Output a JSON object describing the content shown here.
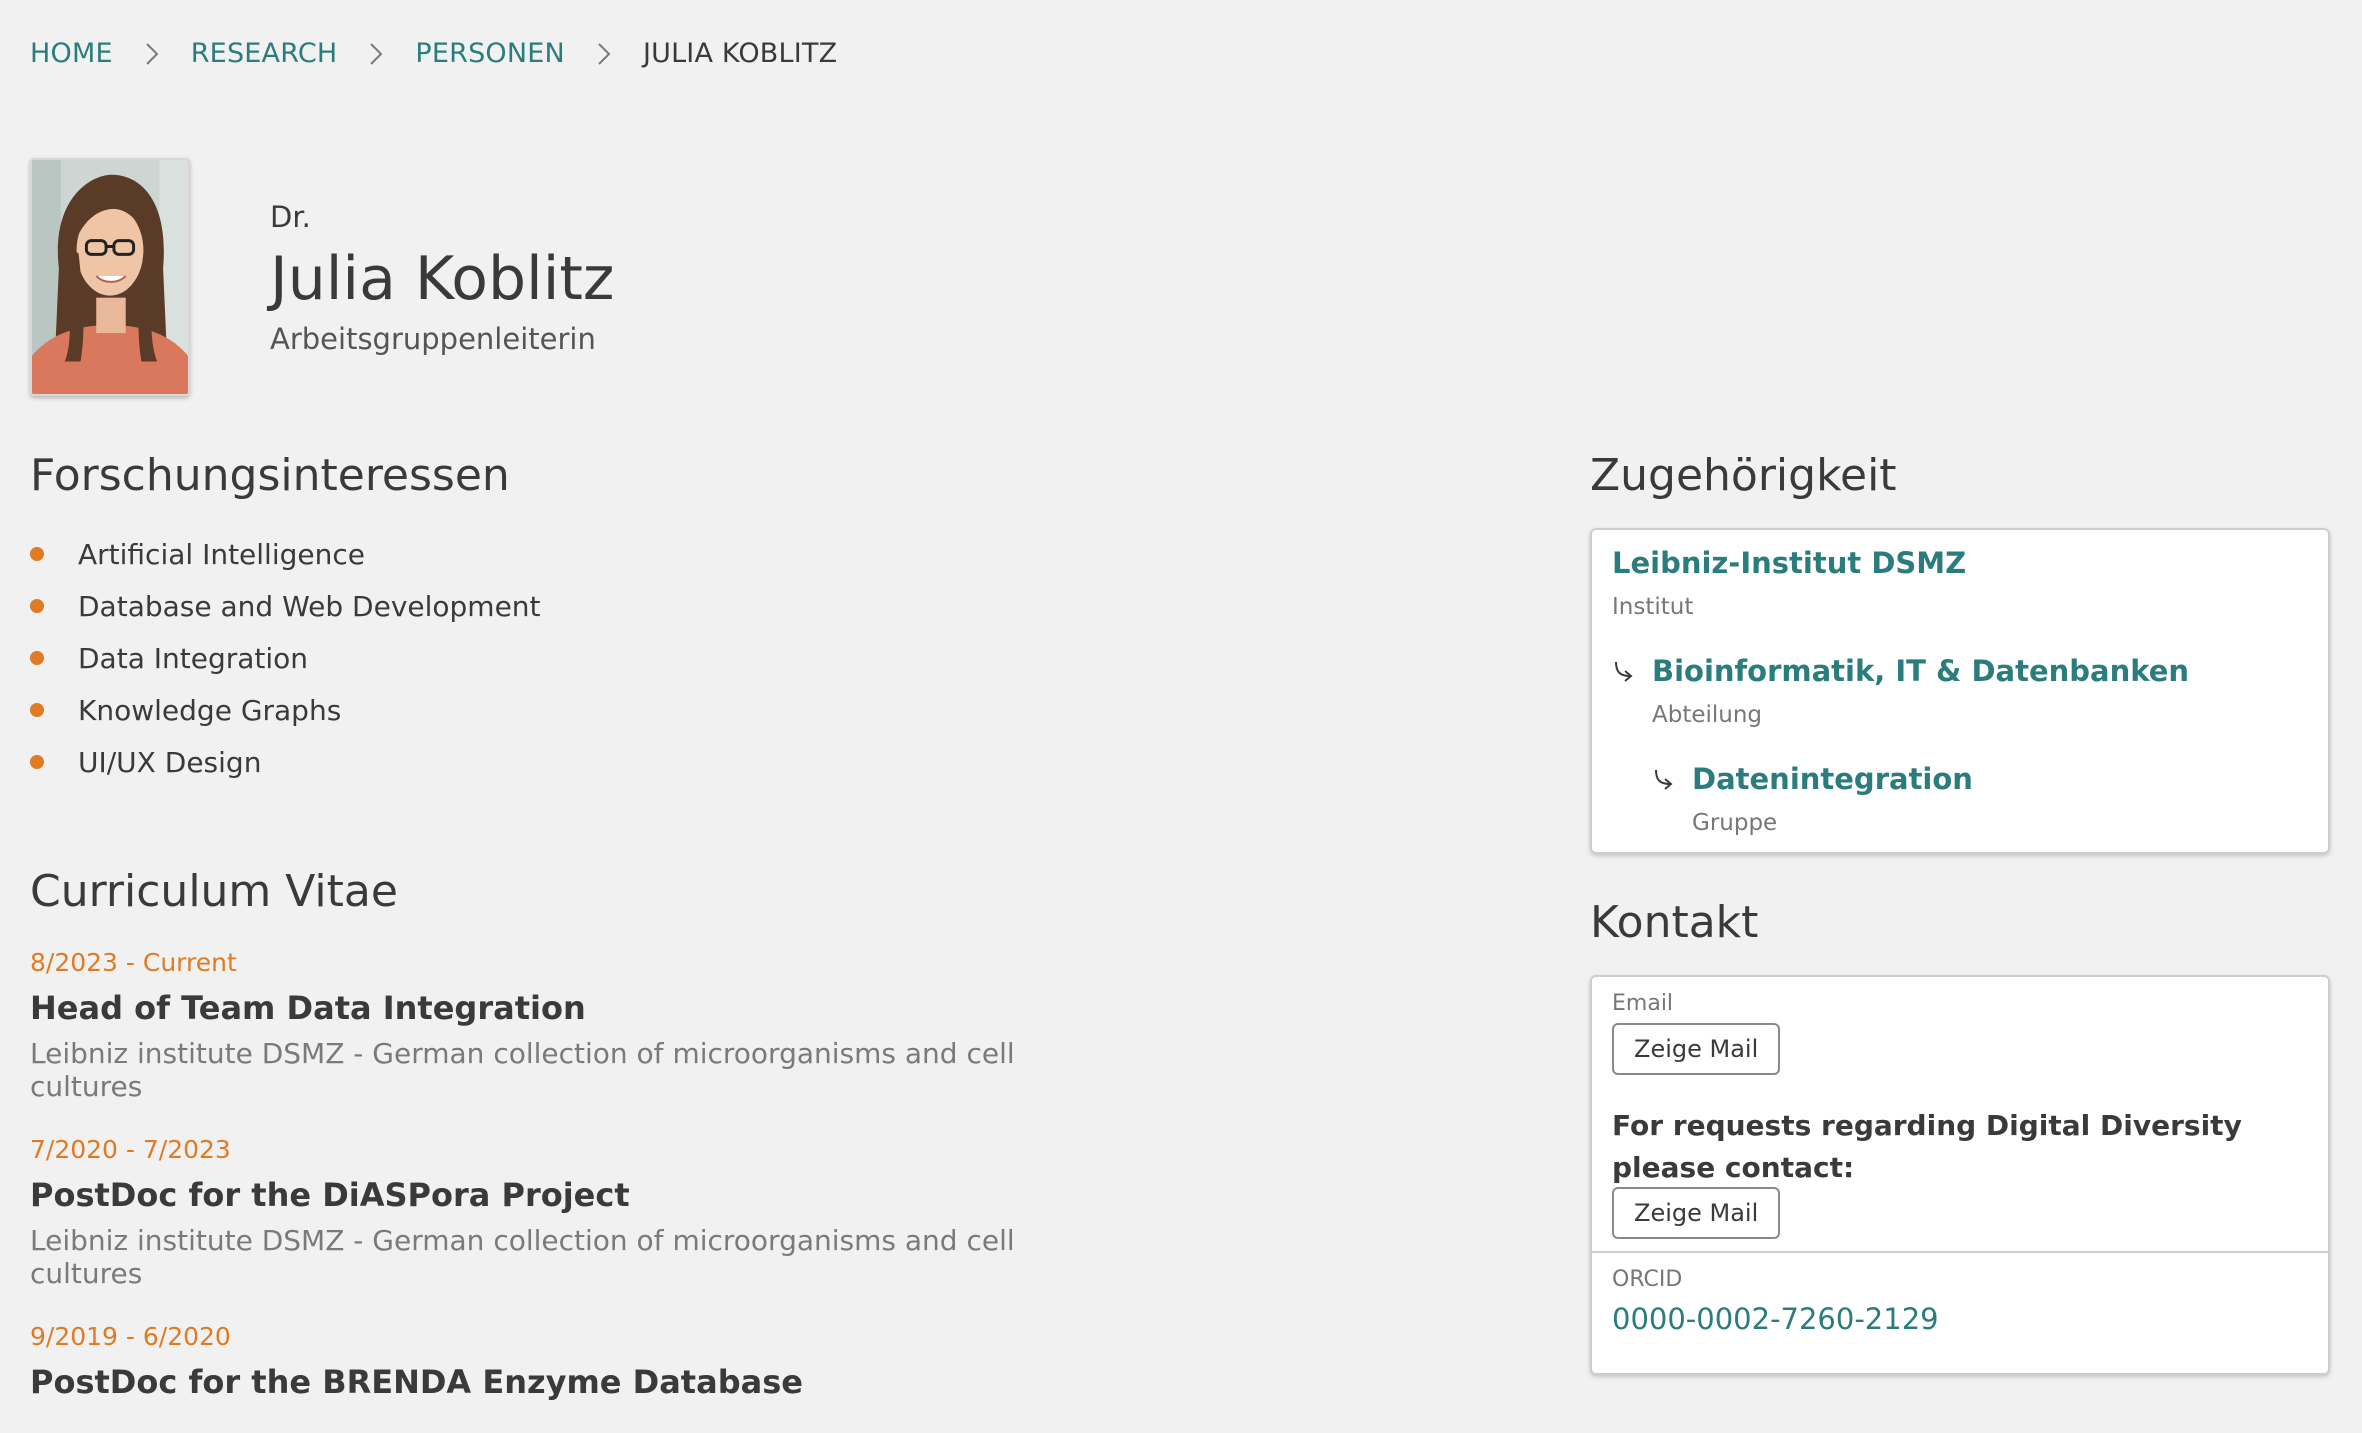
{
  "breadcrumb": {
    "items": [
      "HOME",
      "RESEARCH",
      "PERSONEN"
    ],
    "current": "JULIA KOBLITZ",
    "separator_icon": "chevron-right-icon"
  },
  "profile": {
    "title": "Dr.",
    "name": "Julia Koblitz",
    "role": "Arbeitsgruppenleiterin"
  },
  "interests": {
    "heading": "Forschungsinteressen",
    "items": [
      "Artificial Intelligence",
      "Database and Web Development",
      "Data Integration",
      "Knowledge Graphs",
      "UI/UX Design"
    ],
    "bullet_color": "#e07b24"
  },
  "cv": {
    "heading": "Curriculum Vitae",
    "entries": [
      {
        "date": "8/2023 - Current",
        "title": "Head of Team Data Integration",
        "org": "Leibniz institute DSMZ - German collection of microorganisms and cell cultures"
      },
      {
        "date": "7/2020 - 7/2023",
        "title": "PostDoc for the DiASPora Project",
        "org": "Leibniz institute DSMZ - German collection of microorganisms and cell cultures"
      },
      {
        "date": "9/2019 - 6/2020",
        "title": "PostDoc for the BRENDA Enzyme Database"
      }
    ]
  },
  "affiliation": {
    "heading": "Zugehörigkeit",
    "items": [
      {
        "name": "Leibniz-Institut DSMZ",
        "type": "Institut"
      },
      {
        "name": "Bioinformatik, IT & Datenbanken",
        "type": "Abteilung"
      },
      {
        "name": "Datenintegration",
        "type": "Gruppe"
      }
    ],
    "arrow_icon": "subdirectory-arrow-icon"
  },
  "contact": {
    "heading": "Kontakt",
    "email_label": "Email",
    "show_mail_label": "Zeige Mail",
    "note": "For requests regarding Digital Diversity please contact:",
    "orcid_label": "ORCID",
    "orcid_value": "0000-0002-7260-2129"
  },
  "colors": {
    "accent": "#2b7c7d",
    "highlight": "#e07b24",
    "background": "#f1f1f1"
  }
}
